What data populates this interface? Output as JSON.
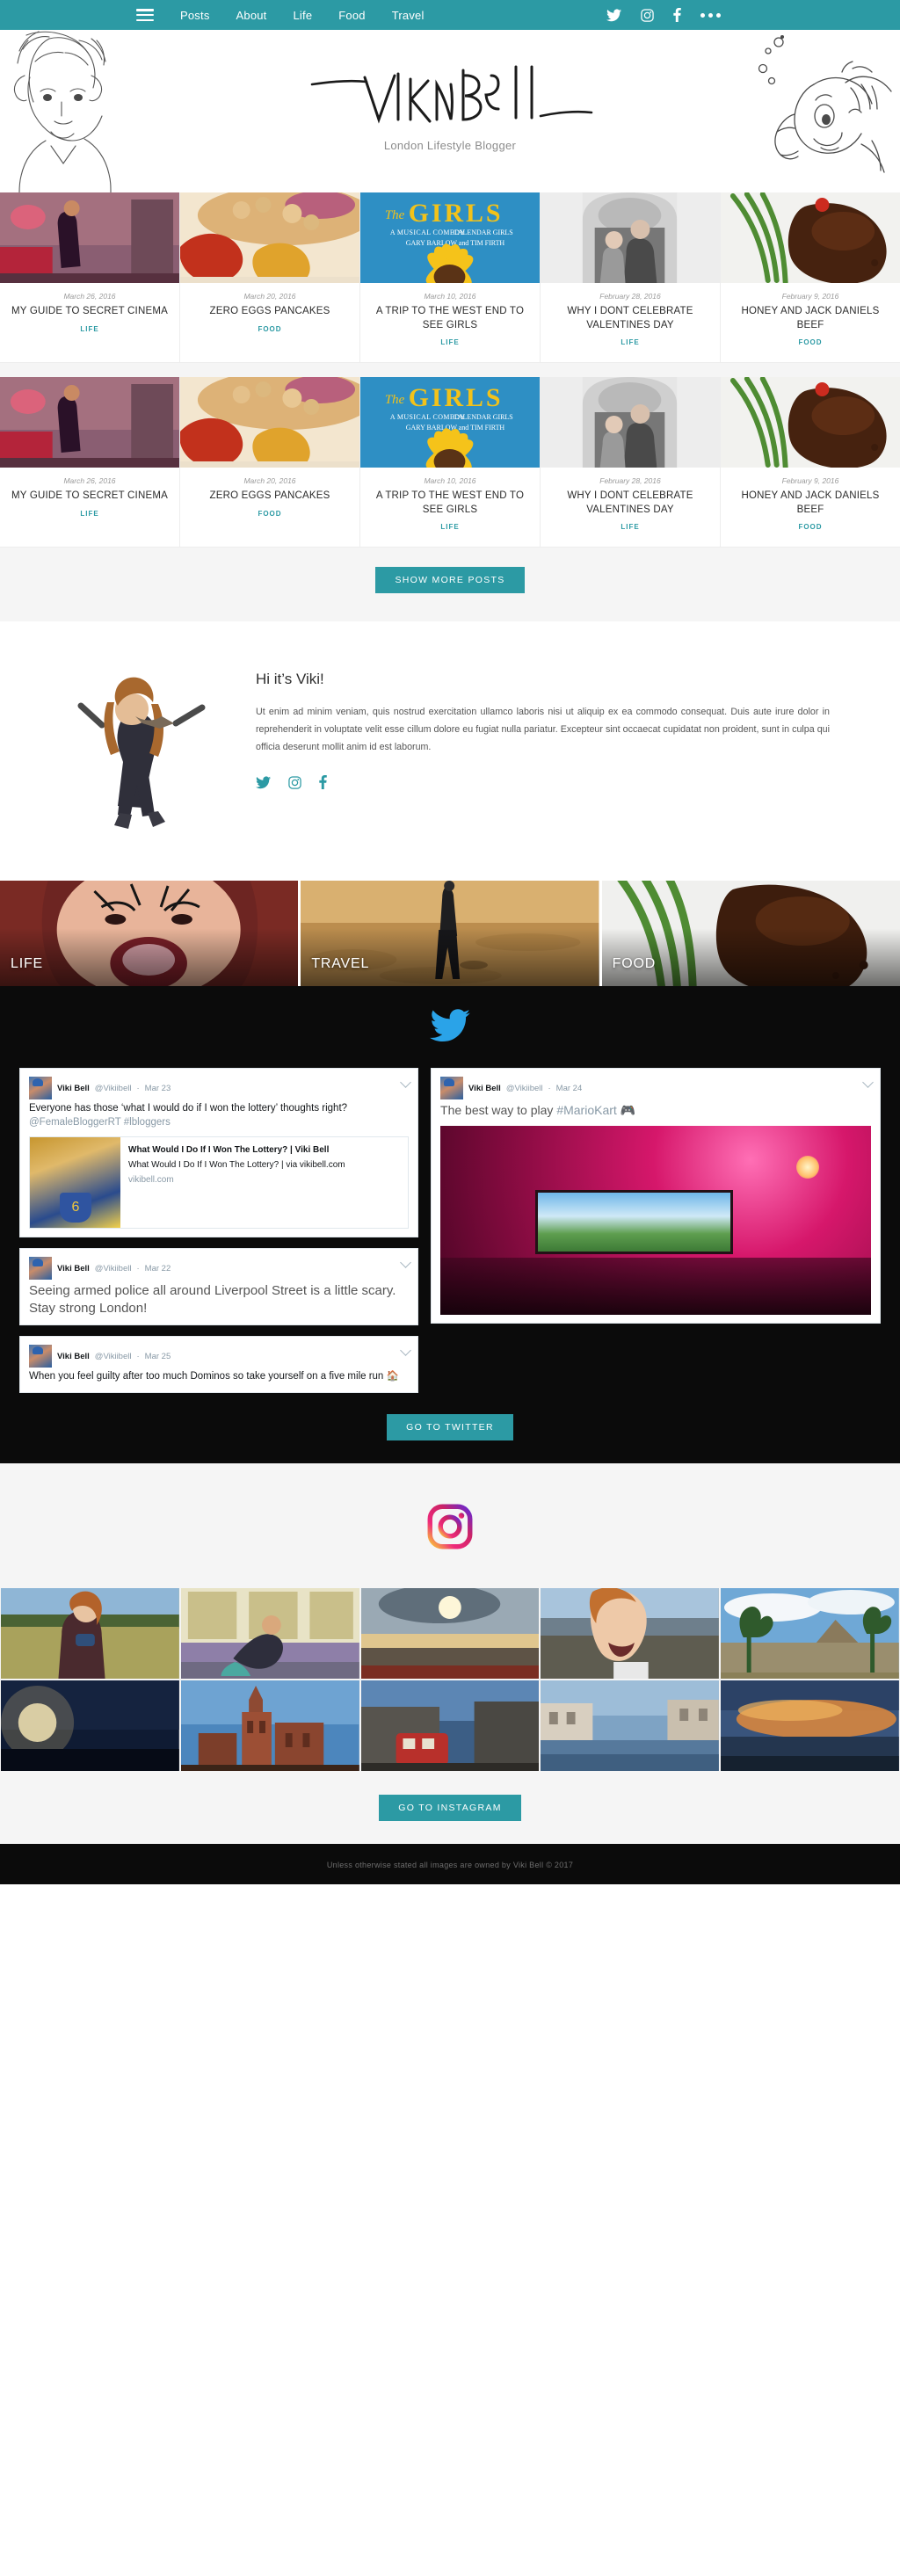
{
  "nav": {
    "menu_icon": "hamburger-icon",
    "links": [
      "Posts",
      "About",
      "Life",
      "Food",
      "Travel"
    ],
    "social": [
      "twitter-icon",
      "instagram-icon",
      "facebook-icon",
      "more-dots-icon"
    ]
  },
  "header": {
    "logo_text": "Viki Bell",
    "tagline": "London Lifestyle Blogger",
    "left_sketch": "portrait-sketch",
    "right_sketch": "fish-sketch"
  },
  "posts": {
    "items": [
      {
        "date": "March 26, 2016",
        "title": "MY GUIDE TO SECRET CINEMA",
        "category": "LIFE"
      },
      {
        "date": "March 20, 2016",
        "title": "ZERO EGGS PANCAKES",
        "category": "FOOD"
      },
      {
        "date": "March 10, 2016",
        "title": "A TRIP TO THE WEST END TO SEE GIRLS",
        "category": "LIFE"
      },
      {
        "date": "February 28, 2016",
        "title": "WHY I DONT CELEBRATE VALENTINES DAY",
        "category": "LIFE"
      },
      {
        "date": "February 9, 2016",
        "title": "HONEY AND JACK DANIELS BEEF",
        "category": "FOOD"
      }
    ],
    "show_more_label": "SHOW MORE POSTS"
  },
  "about": {
    "title": "Hi it’s Viki!",
    "body": "Ut enim ad minim veniam, quis nostrud exercitation ullamco laboris nisi ut aliquip ex ea commodo consequat. Duis aute irure dolor in reprehenderit in voluptate velit esse cillum dolore eu fugiat nulla pariatur. Excepteur sint occaecat cupidatat non proident, sunt in culpa qui officia deserunt mollit anim id est laborum.",
    "social": [
      "twitter-icon",
      "instagram-icon",
      "facebook-icon"
    ]
  },
  "categories": [
    {
      "label": "LIFE"
    },
    {
      "label": "TRAVEL"
    },
    {
      "label": "FOOD"
    }
  ],
  "twitter": {
    "logo": "twitter-bird-icon",
    "button_label": "GO TO TWITTER",
    "tweets": [
      {
        "name": "Viki Bell",
        "handle": "@Vikiibell",
        "date": "Mar 23",
        "text": "Everyone has those ‘what I would do if I won the lottery’ thoughts right? ",
        "mention": "@FemaleBloggerRT",
        "hashtag": " #lbloggers",
        "card": {
          "title": "What Would I Do If I Won The Lottery? | Viki Bell",
          "desc": "What Would I Do If I Won The Lottery? | via vikibell.com",
          "domain": "vikibell.com"
        }
      },
      {
        "name": "Viki Bell",
        "handle": "@Vikiibell",
        "date": "Mar 22",
        "text": "Seeing armed police all around Liverpool Street is a little scary. Stay strong London!"
      },
      {
        "name": "Viki Bell",
        "handle": "@Vikiibell",
        "date": "Mar 25",
        "text": "When you feel guilty after too much Dominos so take yourself on a five mile run 🏠"
      },
      {
        "name": "Viki Bell",
        "handle": "@Vikiibell",
        "date": "Mar 24",
        "text": "The best way to play ",
        "hashtag": "#MarioKart",
        "emoji": " 🎮"
      }
    ]
  },
  "instagram": {
    "logo": "instagram-icon",
    "button_label": "GO TO INSTAGRAM",
    "cells": [
      "woman-with-mug-in-field",
      "yoga-pose-by-window",
      "sunset-over-sea",
      "smiling-selfie-at-beach",
      "palm-trees-and-mountains",
      "dark-sky-with-sun-flare",
      "gothic-station-building",
      "london-street-with-bus",
      "canal-with-buildings",
      "orange-sunset-clouds"
    ]
  },
  "footer": {
    "text": "Unless otherwise stated all images are owned by Viki Bell © 2017"
  },
  "colors": {
    "accent": "#2c9aa4",
    "dark": "#0b0b0b",
    "light": "#f5f5f5"
  }
}
